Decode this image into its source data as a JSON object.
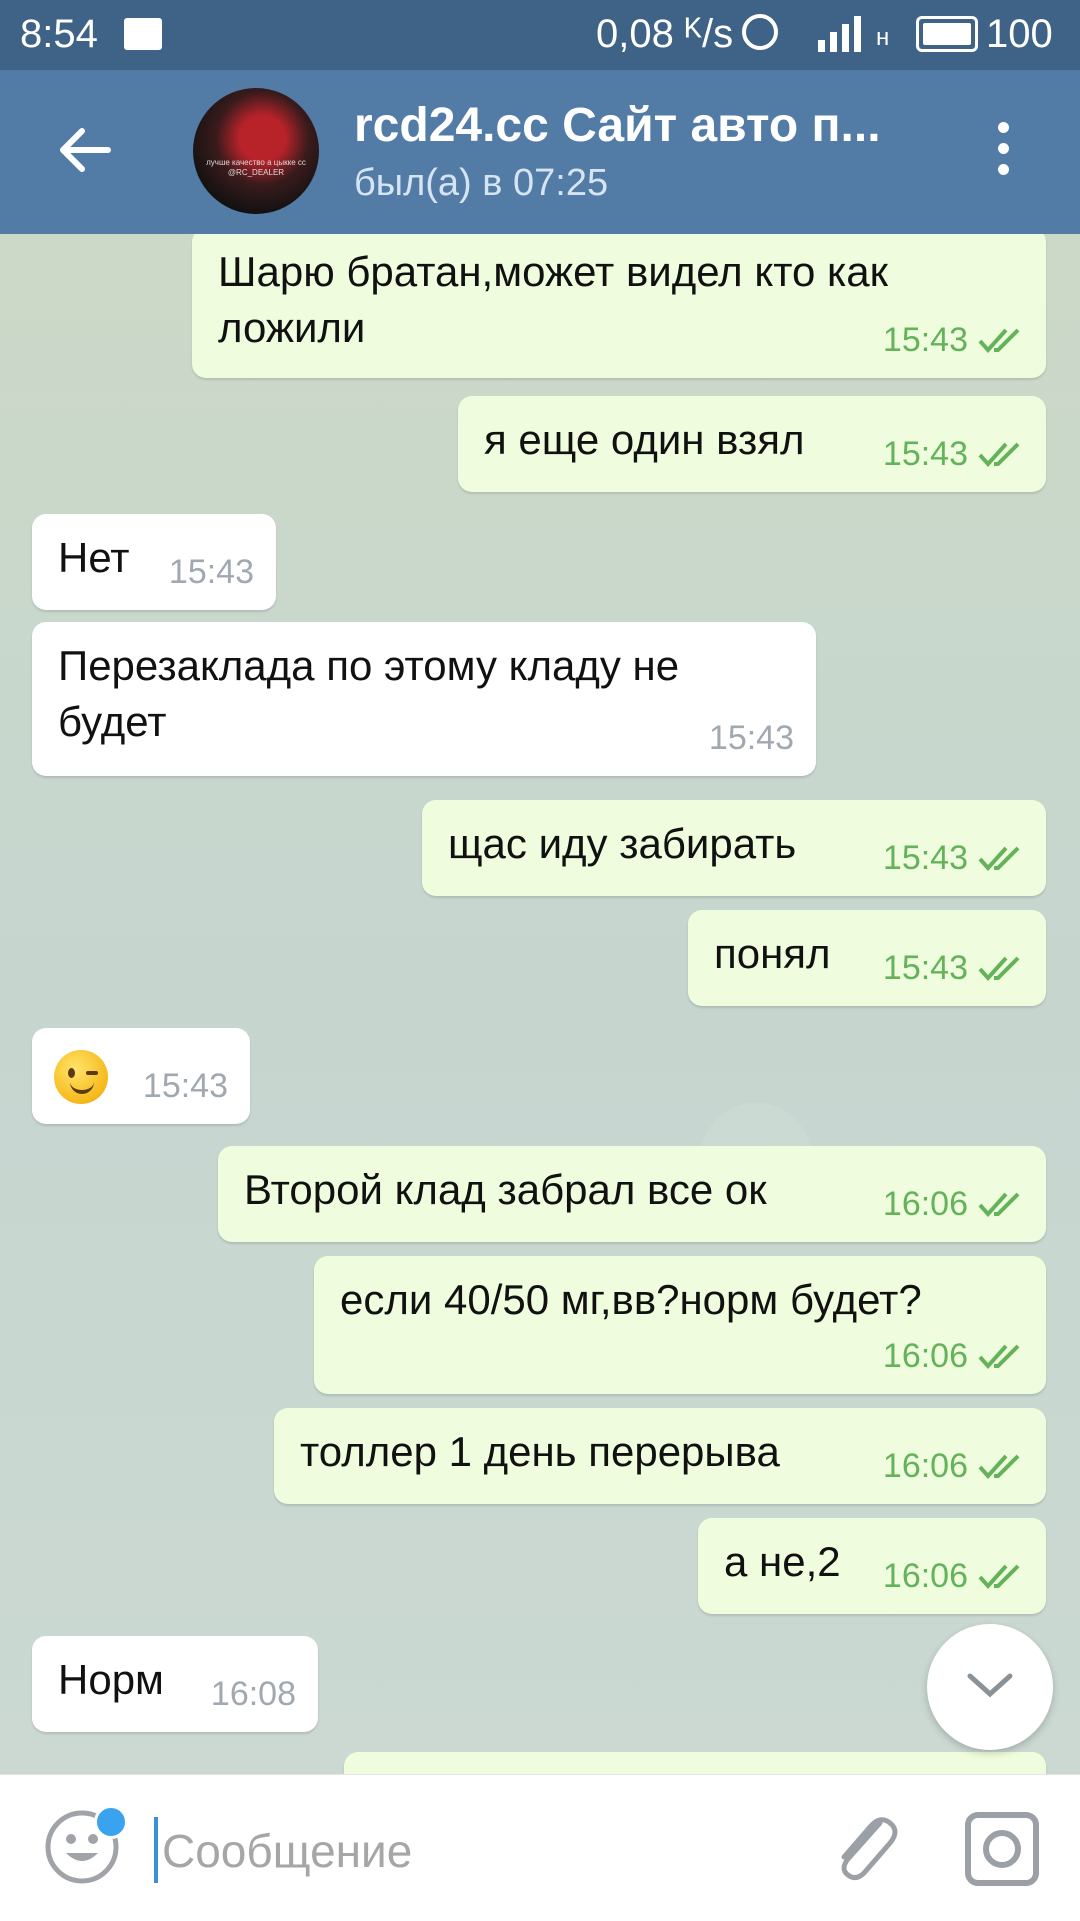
{
  "status_bar": {
    "time": "8:54",
    "network_speed": "0,08 ᴷ/s",
    "signal_type": "н",
    "battery": "100"
  },
  "header": {
    "title": "rcd24.cc Сайт авто п...",
    "subtitle": "был(а) в 07:25",
    "avatar_text": "лучше качество а цыкке сс @RC_DEALER"
  },
  "messages": [
    {
      "direction": "out",
      "text": "Шарю братан,может видел кто как ложили",
      "time": "15:43",
      "read": true
    },
    {
      "direction": "out",
      "text": "я еще один взял",
      "time": "15:43",
      "read": true
    },
    {
      "direction": "in",
      "text": "Нет",
      "time": "15:43"
    },
    {
      "direction": "in",
      "text": "Перезаклада по этому кладу не будет",
      "time": "15:43"
    },
    {
      "direction": "out",
      "text": "щас иду забирать",
      "time": "15:43",
      "read": true
    },
    {
      "direction": "out",
      "text": "понял",
      "time": "15:43",
      "read": true
    },
    {
      "direction": "in",
      "emoji": "winking-face",
      "text": "",
      "time": "15:43"
    },
    {
      "direction": "out",
      "text": "Второй клад забрал все ок",
      "time": "16:06",
      "read": true
    },
    {
      "direction": "out",
      "text": "если 40/50 мг,вв?норм будет?",
      "time": "16:06",
      "read": true
    },
    {
      "direction": "out",
      "text": "толлер 1 день перерыва",
      "time": "16:06",
      "read": true
    },
    {
      "direction": "out",
      "text": "а не,2",
      "time": "16:06",
      "read": true
    },
    {
      "direction": "in",
      "text": "Норм",
      "time": "16:08"
    }
  ],
  "input": {
    "placeholder": "Сообщение",
    "value": ""
  },
  "colors": {
    "header": "#527ca6",
    "status_bar": "#3f6386",
    "outgoing_bubble": "#effdde",
    "incoming_bubble": "#ffffff",
    "read_ticks": "#64b35a",
    "unread_dot": "#3aa3f0"
  },
  "icons": [
    "back-arrow-icon",
    "more-vert-icon",
    "double-check-icon",
    "chevron-down-icon",
    "emoji-icon",
    "attach-icon",
    "camera-icon"
  ]
}
